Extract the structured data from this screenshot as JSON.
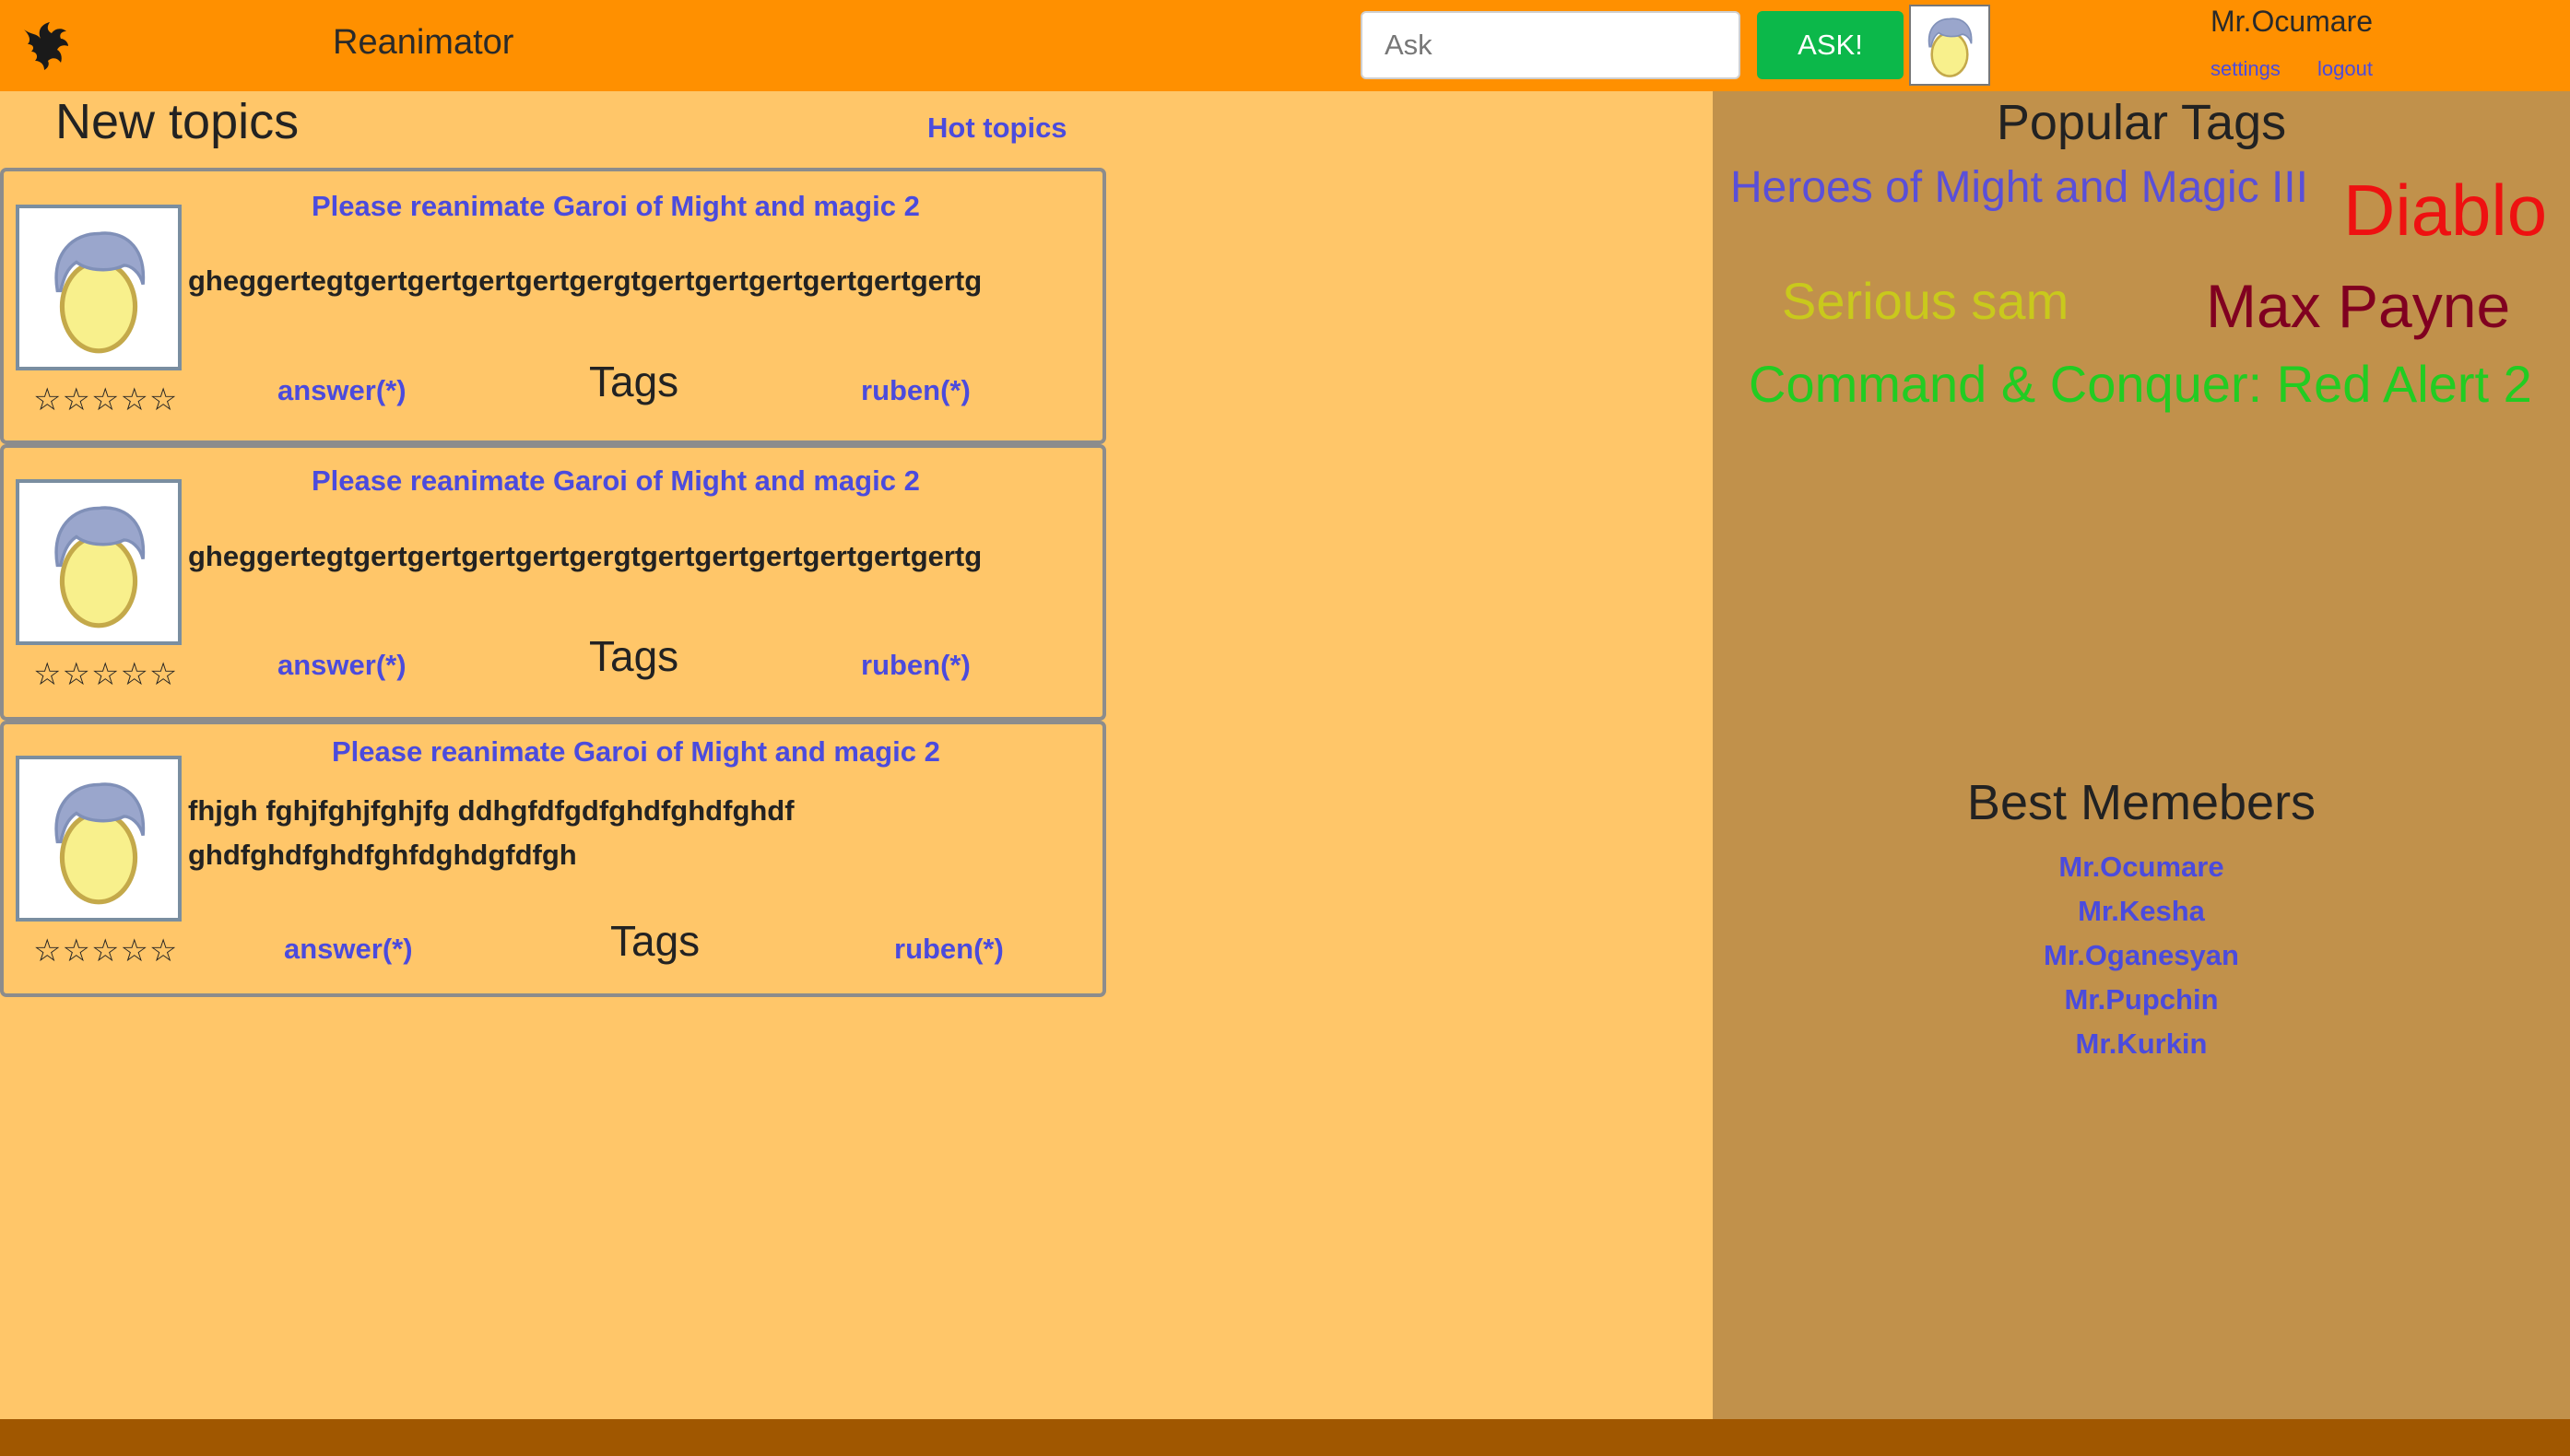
{
  "header": {
    "brand": "Reanimator",
    "search": {
      "placeholder": "Ask",
      "value": ""
    },
    "ask_button": "ASK!",
    "user": {
      "name": "Mr.Ocumare",
      "settings": "settings",
      "logout": "logout"
    }
  },
  "main": {
    "title": "New topics",
    "hot_topics": "Hot topics",
    "topics": [
      {
        "title": "Please reanimate Garoi of Might and magic 2",
        "body": "gheggertegtgertgertgertgertgergtgertgertgertgertgertgertg",
        "stars": "☆☆☆☆☆",
        "answer": "answer(*)",
        "tags": "Tags",
        "author": "ruben(*)"
      },
      {
        "title": "Please reanimate Garoi of Might and magic 2",
        "body": "gheggertegtgertgertgertgertgergtgertgertgertgertgertgertg",
        "stars": "☆☆☆☆☆",
        "answer": "answer(*)",
        "tags": "Tags",
        "author": "ruben(*)"
      },
      {
        "title": "Please reanimate Garoi of Might and magic 2",
        "body_lines": [
          "fhjgh fghjfghjfghjfg ddhgfdfgdfghdfghdfghdf",
          "ghdfghdfghdfghfdghdgfdfgh"
        ],
        "stars": "☆☆☆☆☆",
        "answer": "answer(*)",
        "tags": "Tags",
        "author": "ruben(*)"
      }
    ]
  },
  "sidebar": {
    "popular_title": "Popular Tags",
    "tags": [
      {
        "label": "Heroes of Might and Magic III",
        "color": "#5a4fd8"
      },
      {
        "label": "Diablo",
        "color": "#ee1111"
      },
      {
        "label": "Serious sam",
        "color": "#c9c91c"
      },
      {
        "label": "Max Payne",
        "color": "#800020"
      },
      {
        "label": "Command & Conquer: Red Alert 2",
        "color": "#22cc22"
      }
    ],
    "best_title": "Best Memebers",
    "members": [
      "Mr.Ocumare",
      "Mr.Kesha",
      "Mr.Oganesyan",
      "Mr.Pupchin",
      "Mr.Kurkin"
    ]
  }
}
